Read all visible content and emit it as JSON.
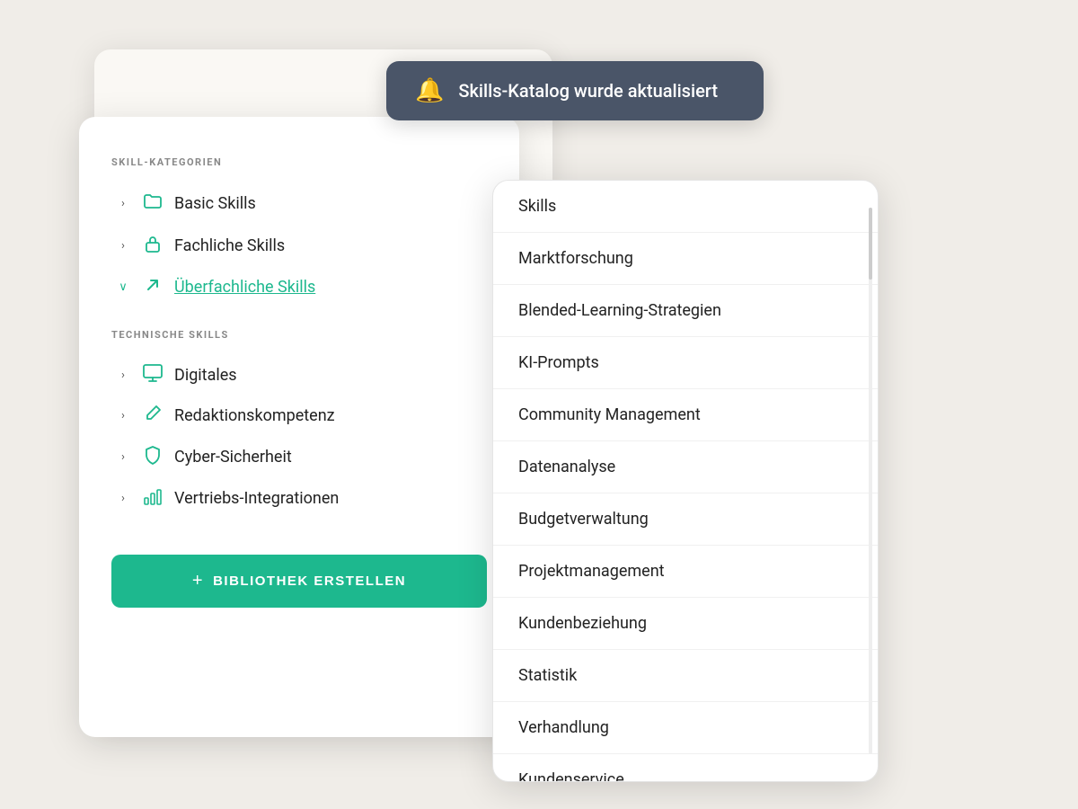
{
  "notification": {
    "icon": "🔔",
    "text": "Skills-Katalog wurde aktualisiert"
  },
  "left_card": {
    "section1_label": "SKILL-KATEGORIEN",
    "skill_categories": [
      {
        "id": "basic-skills",
        "chevron": "›",
        "chevron_open": false,
        "icon": "📁",
        "name": "Basic Skills",
        "active": false
      },
      {
        "id": "fachliche-skills",
        "chevron": "›",
        "chevron_open": false,
        "icon": "🔒",
        "name": "Fachliche Skills",
        "active": false
      },
      {
        "id": "ueberfachliche-skills",
        "chevron": "∨",
        "chevron_open": true,
        "icon": "↗",
        "name": "Überfachliche Skills",
        "active": true
      }
    ],
    "section2_label": "TECHNISCHE SKILLS",
    "tech_skills": [
      {
        "id": "digitales",
        "chevron": "›",
        "icon": "⊟",
        "name": "Digitales"
      },
      {
        "id": "redaktionskompetenz",
        "chevron": "›",
        "icon": "✏",
        "name": "Redaktionskompetenz"
      },
      {
        "id": "cyber-sicherheit",
        "chevron": "›",
        "icon": "🛡",
        "name": "Cyber-Sicherheit"
      },
      {
        "id": "vertriebs-integrationen",
        "chevron": "›",
        "icon": "📊",
        "name": "Vertriebs-Integrationen"
      }
    ],
    "create_button": {
      "icon": "+",
      "label": "BIBLIOTHEK ERSTELLEN"
    }
  },
  "dropdown": {
    "items": [
      "Skills",
      "Marktforschung",
      "Blended-Learning-Strategien",
      "KI-Prompts",
      "Community Management",
      "Datenanalyse",
      "Budgetverwaltung",
      "Projektmanagement",
      "Kundenbeziehung",
      "Statistik",
      "Verhandlung",
      "Kundenservice"
    ]
  }
}
